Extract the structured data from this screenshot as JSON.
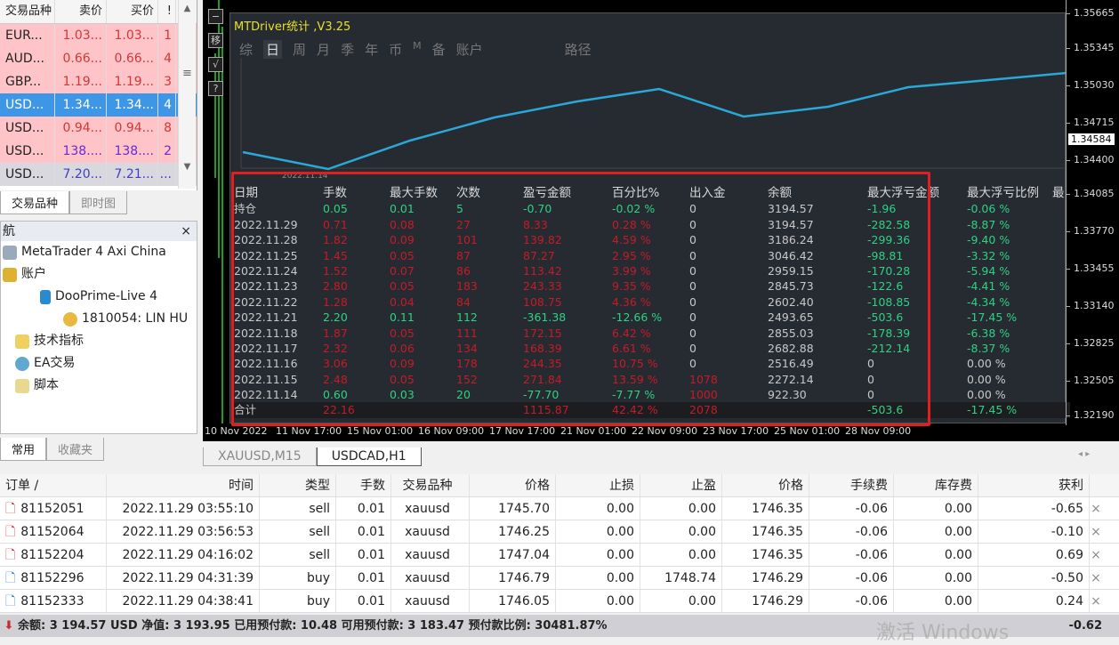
{
  "market_watch": {
    "headers": [
      "交易品种",
      "卖价",
      "买价",
      "!"
    ],
    "rows": [
      [
        "EUR...",
        "1.03...",
        "1.03...",
        "1"
      ],
      [
        "AUD...",
        "0.66...",
        "0.66...",
        "4"
      ],
      [
        "GBP...",
        "1.19...",
        "1.19...",
        "3"
      ],
      [
        "USD...",
        "1.34...",
        "1.34...",
        "4"
      ],
      [
        "USD...",
        "0.94...",
        "0.94...",
        "8"
      ],
      [
        "USD...",
        "138....",
        "138....",
        "2"
      ],
      [
        "USD...",
        "7.20...",
        "7.21...",
        "..."
      ]
    ],
    "selected_row": 3,
    "tabs": [
      "交易品种",
      "即时图"
    ]
  },
  "navigator": {
    "title": "航",
    "items": [
      "MetaTrader 4 Axi China",
      "账户",
      "DooPrime-Live 4",
      "1810054: LIN HU",
      "技术指标",
      "EA交易",
      "脚本"
    ],
    "tabs": [
      "常用",
      "收藏夹"
    ]
  },
  "chart": {
    "buttons": [
      "−",
      "移",
      "√",
      "?"
    ],
    "price_labels": [
      "1.35665",
      "1.35345",
      "1.35030",
      "1.34715",
      "1.34400",
      "1.34085",
      "1.33770",
      "1.33455",
      "1.33140",
      "1.32825",
      "1.32505",
      "1.32190"
    ],
    "current_price": "1.34584",
    "time_labels": [
      "10 Nov 2022",
      "11 Nov 17:00",
      "15 Nov 01:00",
      "16 Nov 09:00",
      "17 Nov 17:00",
      "21 Nov 01:00",
      "22 Nov 09:00",
      "23 Nov 17:00",
      "25 Nov 01:00",
      "28 Nov 09:00"
    ],
    "tabs": [
      "XAUUSD,M15",
      "USDCAD,H1"
    ]
  },
  "panel": {
    "title": "MTDriver统计 ,V3.25",
    "tabs": [
      "综",
      "日",
      "周",
      "月",
      "季",
      "年",
      "币",
      "M",
      "备",
      "账户",
      "路径"
    ],
    "active_tab": "日",
    "line_date": "2022.11.14",
    "headers": [
      "日期",
      "手数",
      "最大手数",
      "次数",
      "盈亏金额",
      "百分比%",
      "出入金",
      "余额",
      "最大浮亏金额",
      "最大浮亏比例",
      "最"
    ],
    "rows": [
      [
        "持仓",
        "0.05",
        "0.01",
        "5",
        "-0.70",
        "-0.02 %",
        "0",
        "3194.57",
        "-1.96",
        "-0.06 %"
      ],
      [
        "2022.11.29",
        "0.71",
        "0.08",
        "27",
        "8.33",
        "0.28 %",
        "0",
        "3194.57",
        "-282.58",
        "-8.87 %"
      ],
      [
        "2022.11.28",
        "1.82",
        "0.09",
        "101",
        "139.82",
        "4.59 %",
        "0",
        "3186.24",
        "-299.36",
        "-9.40 %"
      ],
      [
        "2022.11.25",
        "1.45",
        "0.05",
        "87",
        "87.27",
        "2.95 %",
        "0",
        "3046.42",
        "-98.81",
        "-3.32 %"
      ],
      [
        "2022.11.24",
        "1.52",
        "0.07",
        "86",
        "113.42",
        "3.99 %",
        "0",
        "2959.15",
        "-170.28",
        "-5.94 %"
      ],
      [
        "2022.11.23",
        "2.80",
        "0.05",
        "183",
        "243.33",
        "9.35 %",
        "0",
        "2845.73",
        "-122.6",
        "-4.41 %"
      ],
      [
        "2022.11.22",
        "1.28",
        "0.04",
        "84",
        "108.75",
        "4.36 %",
        "0",
        "2602.40",
        "-108.85",
        "-4.34 %"
      ],
      [
        "2022.11.21",
        "2.20",
        "0.11",
        "112",
        "-361.38",
        "-12.66 %",
        "0",
        "2493.65",
        "-503.6",
        "-17.45 %"
      ],
      [
        "2022.11.18",
        "1.87",
        "0.05",
        "111",
        "172.15",
        "6.42 %",
        "0",
        "2855.03",
        "-178.39",
        "-6.38 %"
      ],
      [
        "2022.11.17",
        "2.32",
        "0.06",
        "134",
        "168.39",
        "6.61 %",
        "0",
        "2682.88",
        "-212.14",
        "-8.37 %"
      ],
      [
        "2022.11.16",
        "3.06",
        "0.09",
        "178",
        "244.35",
        "10.75 %",
        "0",
        "2516.49",
        "0",
        "0.00 %"
      ],
      [
        "2022.11.15",
        "2.48",
        "0.05",
        "152",
        "271.84",
        "13.59 %",
        "1078",
        "2272.14",
        "0",
        "0.00 %"
      ],
      [
        "2022.11.14",
        "0.60",
        "0.03",
        "20",
        "-77.70",
        "-7.77 %",
        "1000",
        "922.30",
        "0",
        "0.00 %"
      ]
    ],
    "total": [
      "合计",
      "22.16",
      "",
      "",
      "1115.87",
      "42.42 %",
      "2078",
      "",
      "-503.6",
      "-17.45 %"
    ],
    "colors": {
      "profit": "#c41c28",
      "loss": "#2fd283",
      "line": "#2aa8d8",
      "highlight_box": "#e02020"
    }
  },
  "orders": {
    "headers": [
      "订单 /",
      "时间",
      "类型",
      "手数",
      "交易品种",
      "价格",
      "止损",
      "止盈",
      "价格",
      "手续费",
      "库存费",
      "获利"
    ],
    "rows": [
      [
        "81152051",
        "2022.11.29 03:55:10",
        "sell",
        "0.01",
        "xauusd",
        "1745.70",
        "0.00",
        "0.00",
        "1746.35",
        "-0.06",
        "0.00",
        "-0.65"
      ],
      [
        "81152064",
        "2022.11.29 03:56:53",
        "sell",
        "0.01",
        "xauusd",
        "1746.25",
        "0.00",
        "0.00",
        "1746.35",
        "-0.06",
        "0.00",
        "-0.10"
      ],
      [
        "81152204",
        "2022.11.29 04:16:02",
        "sell",
        "0.01",
        "xauusd",
        "1747.04",
        "0.00",
        "0.00",
        "1746.35",
        "-0.06",
        "0.00",
        "0.69"
      ],
      [
        "81152296",
        "2022.11.29 04:31:39",
        "buy",
        "0.01",
        "xauusd",
        "1746.79",
        "0.00",
        "1748.74",
        "1746.29",
        "-0.06",
        "0.00",
        "-0.50"
      ],
      [
        "81152333",
        "2022.11.29 04:38:41",
        "buy",
        "0.01",
        "xauusd",
        "1746.05",
        "0.00",
        "0.00",
        "1746.29",
        "-0.06",
        "0.00",
        "0.24"
      ]
    ],
    "footer": "余额: 3 194.57 USD  净值: 3 193.95  已用预付款: 10.48  可用预付款: 3 183.47  预付款比例: 30481.87%",
    "footer_total": "-0.62"
  },
  "watermark": "激活 Windows"
}
